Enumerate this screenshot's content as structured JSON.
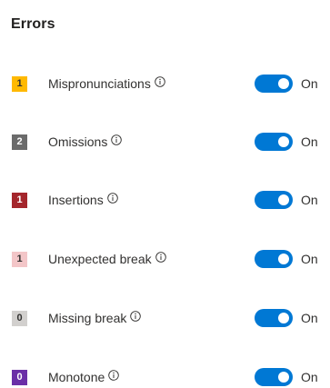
{
  "title": "Errors",
  "colors": {
    "toggle_on": "#0078d4",
    "mispronunciations": "#ffb900",
    "omissions": "#6b6b6b",
    "insertions": "#a4262c",
    "unexpected_break": "#f3c6c8",
    "missing_break": "#d2d0ce",
    "monotone": "#6b2fa7"
  },
  "icons": {
    "info": "info-icon",
    "toggle": "toggle-switch"
  },
  "errors": [
    {
      "key": "mispronunciations",
      "count": "1",
      "label": "Mispronunciations",
      "toggle_state": "On",
      "enabled": true
    },
    {
      "key": "omissions",
      "count": "2",
      "label": "Omissions",
      "toggle_state": "On",
      "enabled": true
    },
    {
      "key": "insertions",
      "count": "1",
      "label": "Insertions",
      "toggle_state": "On",
      "enabled": true
    },
    {
      "key": "unexpected_break",
      "count": "1",
      "label": "Unexpected break",
      "toggle_state": "On",
      "enabled": true
    },
    {
      "key": "missing_break",
      "count": "0",
      "label": "Missing break",
      "toggle_state": "On",
      "enabled": true
    },
    {
      "key": "monotone",
      "count": "0",
      "label": "Monotone",
      "toggle_state": "On",
      "enabled": true
    }
  ]
}
